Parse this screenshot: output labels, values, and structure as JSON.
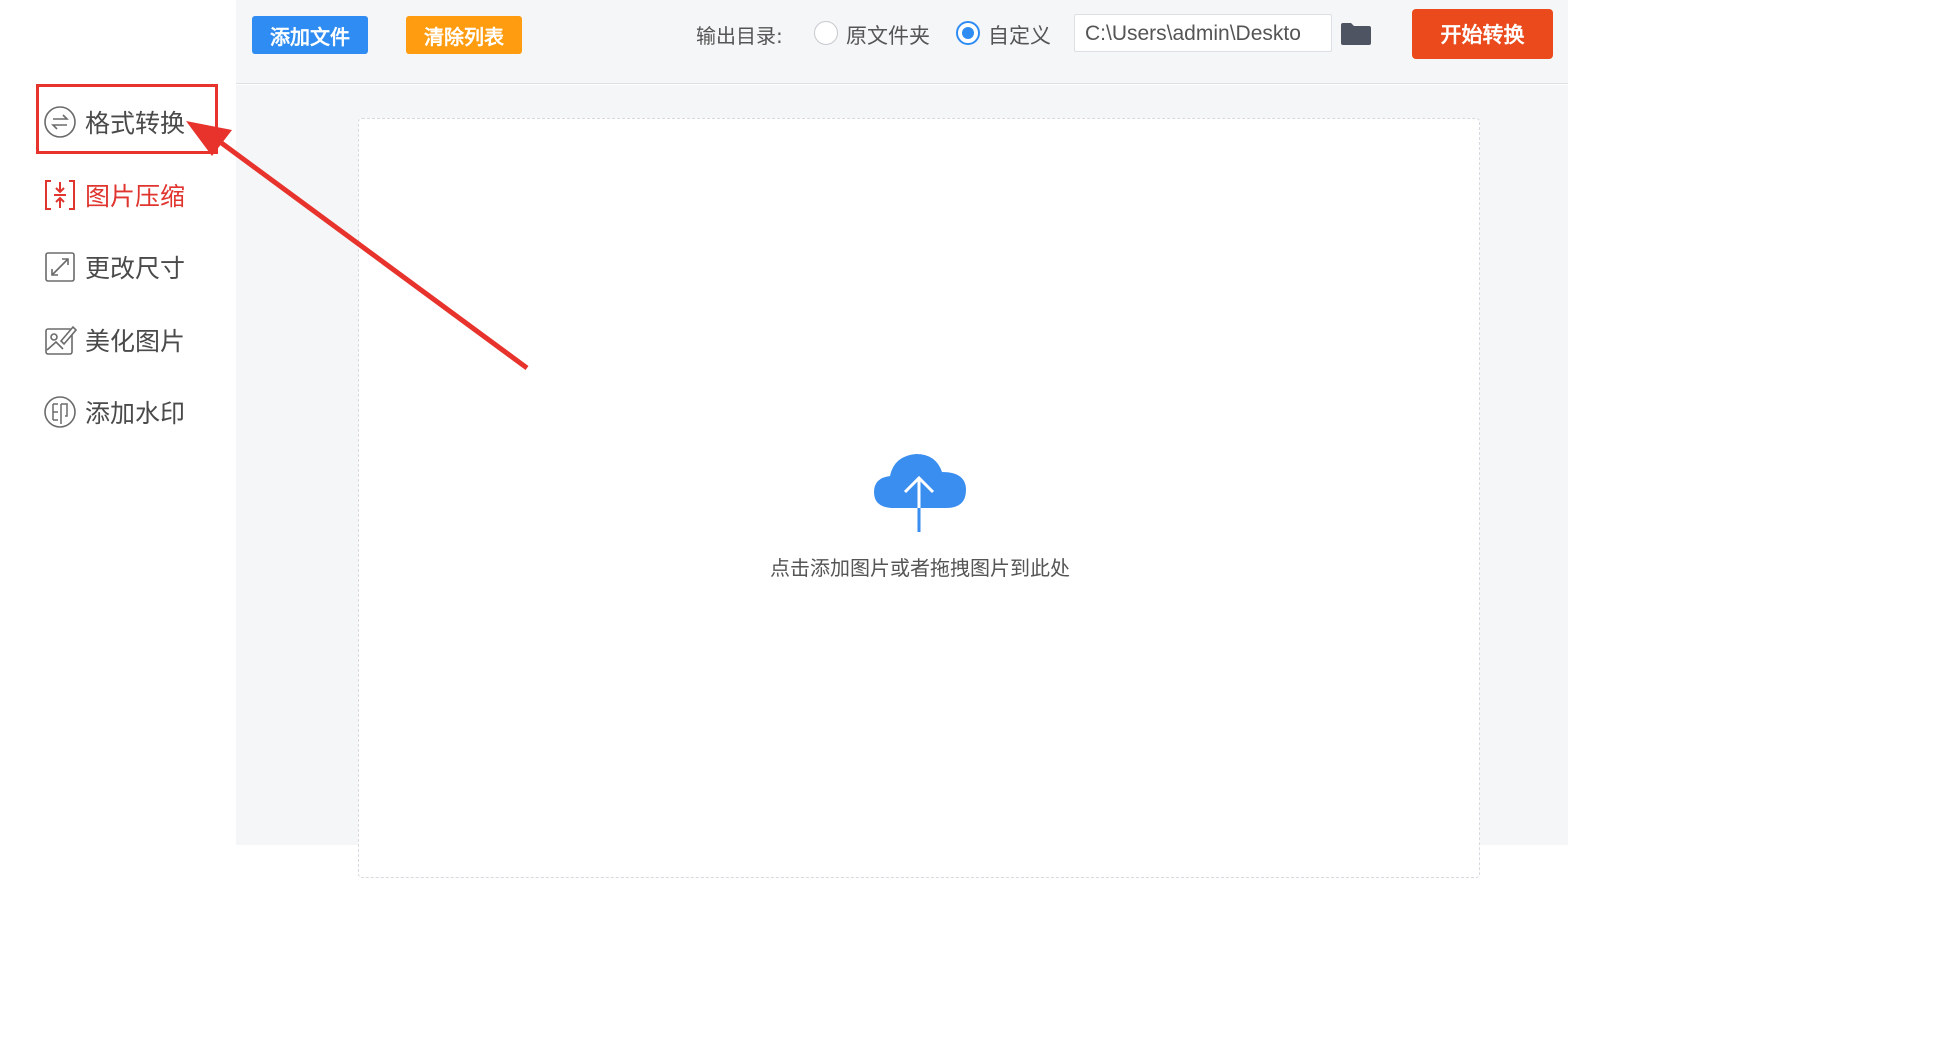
{
  "sidebar": {
    "items": [
      {
        "label": "格式转换",
        "icon": "format-convert-icon"
      },
      {
        "label": "图片压缩",
        "icon": "compress-icon"
      },
      {
        "label": "更改尺寸",
        "icon": "resize-icon"
      },
      {
        "label": "美化图片",
        "icon": "beautify-icon"
      },
      {
        "label": "添加水印",
        "icon": "watermark-icon"
      }
    ]
  },
  "toolbar": {
    "add_files_label": "添加文件",
    "clear_list_label": "清除列表",
    "output_dir_label": "输出目录:",
    "option_source_label": "原文件夹",
    "option_custom_label": "自定义",
    "selected_option": "自定义",
    "output_path": "C:\\Users\\admin\\Deskto",
    "start_label": "开始转换"
  },
  "dropzone": {
    "hint": "点击添加图片或者拖拽图片到此处",
    "icon": "cloud-upload-icon"
  },
  "colors": {
    "primary_blue": "#2f8cf2",
    "orange": "#ff9c10",
    "start_red": "#ea4a1c",
    "highlight_red": "#e8322c"
  }
}
